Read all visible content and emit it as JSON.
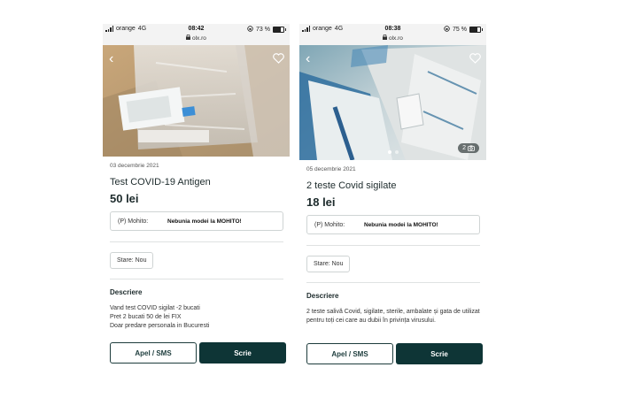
{
  "colors": {
    "primary_dark": "#0e3536",
    "text": "#1d2b2c",
    "border": "#cfd4d4"
  },
  "icons": {
    "back": "chevron-left-icon",
    "favorite": "heart-icon",
    "camera": "camera-icon",
    "lock": "lock-icon",
    "battery": "battery-icon"
  },
  "screens": [
    {
      "status": {
        "carrier": "orange",
        "network": "4G",
        "time": "08:42",
        "url": "olx.ro",
        "battery": "73 %",
        "battery_level": 0.73
      },
      "listing": {
        "date": "03 decembrie 2021",
        "title": "Test COVID-19 Antigen",
        "price": "50 lei",
        "promo_seller": "(P) Mohito:",
        "promo_slogan": "Nebunia modei la MOHITO!",
        "condition": "Stare: Nou",
        "description_heading": "Descriere",
        "description": [
          "Vand test COVID sigilat -2 bucati",
          "Pret 2 bucati 50 de lei FIX",
          "Doar predare personala in Bucuresti"
        ]
      },
      "actions": {
        "call": "Apel / SMS",
        "write": "Scrie"
      }
    },
    {
      "status": {
        "carrier": "orange",
        "network": "4G",
        "time": "08:38",
        "url": "olx.ro",
        "battery": "75 %",
        "battery_level": 0.75
      },
      "listing": {
        "date": "05 decembrie 2021",
        "title": "2 teste Covid sigilate",
        "price": "18 lei",
        "photo_count": "2",
        "promo_seller": "(P) Mohito:",
        "promo_slogan": "Nebunia modei la MOHITO!",
        "condition": "Stare: Nou",
        "description_heading": "Descriere",
        "description": [
          "2 teste salivă Covid, sigilate, sterile, ambalate și gata de utilizat pentru toți cei care au dubii în privința virusului."
        ]
      },
      "actions": {
        "call": "Apel / SMS",
        "write": "Scrie"
      }
    }
  ]
}
